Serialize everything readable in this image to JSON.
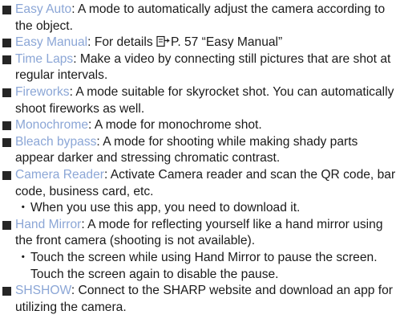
{
  "entries": [
    {
      "term": "Easy Auto",
      "desc": ": A mode to automatically adjust the camera according to the object."
    },
    {
      "term": "Easy Manual",
      "desc_before": ": For details ",
      "ref_icon": "page-reference-icon",
      "desc_after": "P. 57 “Easy Manual”"
    },
    {
      "term": "Time Laps",
      "desc": ": Make a video by connecting still pictures that are shot at regular intervals."
    },
    {
      "term": "Fireworks",
      "desc": ": A mode suitable for skyrocket shot. You can automatically shoot fireworks as well."
    },
    {
      "term": "Monochrome",
      "desc": ": A mode for monochrome shot."
    },
    {
      "term": "Bleach bypass",
      "desc": ": A mode for shooting while making shady parts appear darker and stressing chromatic contrast."
    },
    {
      "term": "Camera Reader",
      "desc": ": Activate Camera reader and scan the QR code, bar code, business card, etc.",
      "note_marker": "・",
      "note": "When you use this app, you need to download it."
    },
    {
      "term": "Hand Mirror",
      "desc": ": A mode for reflecting yourself like a hand mirror using the front camera (shooting is not available).",
      "note_marker": "・",
      "note": "Touch the screen while using Hand Mirror to pause the screen. Touch the screen again to disable the pause."
    },
    {
      "term": "SHSHOW",
      "desc": ": Connect to the SHARP website and download an app for utilizing the camera."
    }
  ],
  "colors": {
    "term": "#8ba6d6",
    "text": "#1a1a1a",
    "bullet": "#262626"
  }
}
